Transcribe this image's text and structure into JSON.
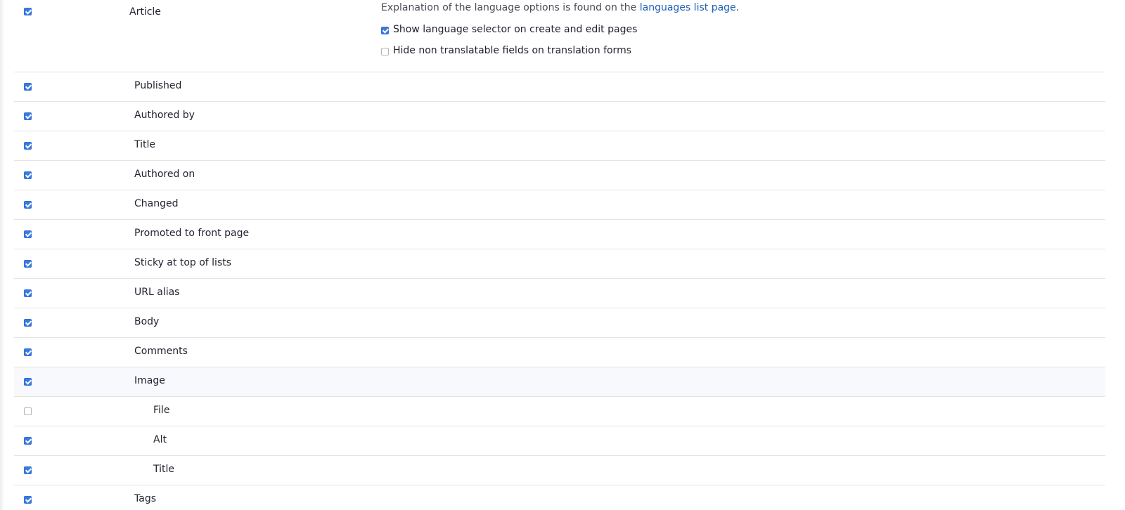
{
  "article": {
    "checked": true,
    "label": "Article",
    "explanation_text": "Explanation of the language options is found on the ",
    "explanation_link": "languages list page",
    "explanation_end": ".",
    "options": [
      {
        "label": "Show language selector on create and edit pages",
        "checked": true
      },
      {
        "label": "Hide non translatable fields on translation forms",
        "checked": false
      }
    ]
  },
  "fields": [
    {
      "label": "Published",
      "checked": true,
      "level": 1
    },
    {
      "label": "Authored by",
      "checked": true,
      "level": 1
    },
    {
      "label": "Title",
      "checked": true,
      "level": 1
    },
    {
      "label": "Authored on",
      "checked": true,
      "level": 1
    },
    {
      "label": "Changed",
      "checked": true,
      "level": 1
    },
    {
      "label": "Promoted to front page",
      "checked": true,
      "level": 1
    },
    {
      "label": "Sticky at top of lists",
      "checked": true,
      "level": 1
    },
    {
      "label": "URL alias",
      "checked": true,
      "level": 1
    },
    {
      "label": "Body",
      "checked": true,
      "level": 1
    },
    {
      "label": "Comments",
      "checked": true,
      "level": 1
    },
    {
      "label": "Image",
      "checked": true,
      "level": 1,
      "highlight": true
    },
    {
      "label": "File",
      "checked": false,
      "level": 2
    },
    {
      "label": "Alt",
      "checked": true,
      "level": 2
    },
    {
      "label": "Title",
      "checked": true,
      "level": 2
    },
    {
      "label": "Tags",
      "checked": true,
      "level": 1
    }
  ]
}
